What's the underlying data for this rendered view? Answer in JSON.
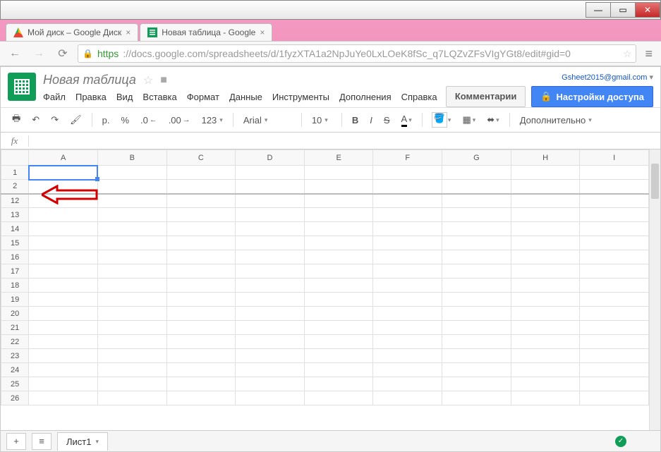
{
  "window": {
    "title": "Browser Window"
  },
  "tabs": [
    {
      "label": "Мой диск – Google Диск"
    },
    {
      "label": "Новая таблица - Google"
    }
  ],
  "url": {
    "scheme": "https",
    "rest": "://docs.google.com/spreadsheets/d/1fyzXTA1a2NpJuYe0LxLOeK8fSc_q7LQZvZFsVIgYGt8/edit#gid=0"
  },
  "doc": {
    "title": "Новая таблица"
  },
  "user": {
    "email": "Gsheet2015@gmail.com"
  },
  "menus": {
    "file": "Файл",
    "edit": "Правка",
    "view": "Вид",
    "insert": "Вставка",
    "format": "Формат",
    "data": "Данные",
    "tools": "Инструменты",
    "addons": "Дополнения",
    "help": "Справка"
  },
  "buttons": {
    "comments": "Комментарии",
    "share": "Настройки доступа"
  },
  "toolbar": {
    "currency": "р.",
    "percent": "%",
    "dec_dec": ".0←",
    "inc_dec": ".00→",
    "num_format": "123",
    "font": "Arial",
    "size": "10",
    "bold": "B",
    "italic": "I",
    "strike": "S",
    "textcolor": "A",
    "more": "Дополнительно"
  },
  "columns": [
    "A",
    "B",
    "C",
    "D",
    "E",
    "F",
    "G",
    "H",
    "I"
  ],
  "rows": [
    1,
    2,
    12,
    13,
    14,
    15,
    16,
    17,
    18,
    19,
    20,
    21,
    22,
    23,
    24,
    25,
    26
  ],
  "formula": {
    "label": "fx",
    "value": ""
  },
  "sheet": {
    "name": "Лист1"
  }
}
